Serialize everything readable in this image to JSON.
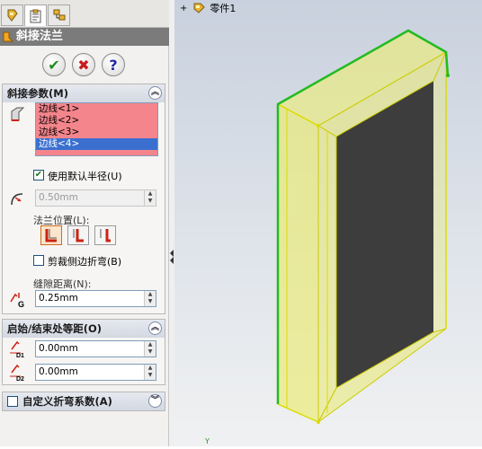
{
  "panel": {
    "tabs": [
      {
        "icon": "feature-manager-icon"
      },
      {
        "icon": "property-manager-icon"
      },
      {
        "icon": "configuration-manager-icon"
      }
    ],
    "title": "斜接法兰",
    "buttons": {
      "ok": "✔",
      "cancel": "✖",
      "help": "?"
    }
  },
  "miter_params": {
    "header": "斜接参数(M)",
    "edges": [
      "边线<1>",
      "边线<2>",
      "边线<3>",
      "边线<4>"
    ],
    "selected_edge_index": 3,
    "use_default_radius_label": "使用默认半径(U)",
    "use_default_radius_checked": true,
    "radius_value": "0.50mm",
    "flange_position_label": "法兰位置(L):",
    "flange_position_selected": 0,
    "trim_side_bends_label": "剪裁侧边折弯(B)",
    "trim_side_bends_checked": false,
    "gap_distance_label": "缝隙距离(N):",
    "gap_distance_value": "0.25mm",
    "gap_icon_letter": "G"
  },
  "offset": {
    "header": "启始/结束处等距(O)",
    "d1_value": "0.00mm",
    "d2_value": "0.00mm",
    "d1_label": "D1",
    "d2_label": "D2"
  },
  "custom_bend": {
    "header": "自定义折弯系数(A)",
    "checked": false
  },
  "viewport": {
    "tree_expander": "+",
    "tree_item": "零件1",
    "axis_label": "Y"
  },
  "colors": {
    "title_bg": "#7b7b7b",
    "edge_fill": "#f4858c",
    "edge_selected": "#3a6fd0",
    "preview_yellow": "#eeee00",
    "selected_edge_green": "#22bb22",
    "face_dark": "#3d3d3d"
  }
}
